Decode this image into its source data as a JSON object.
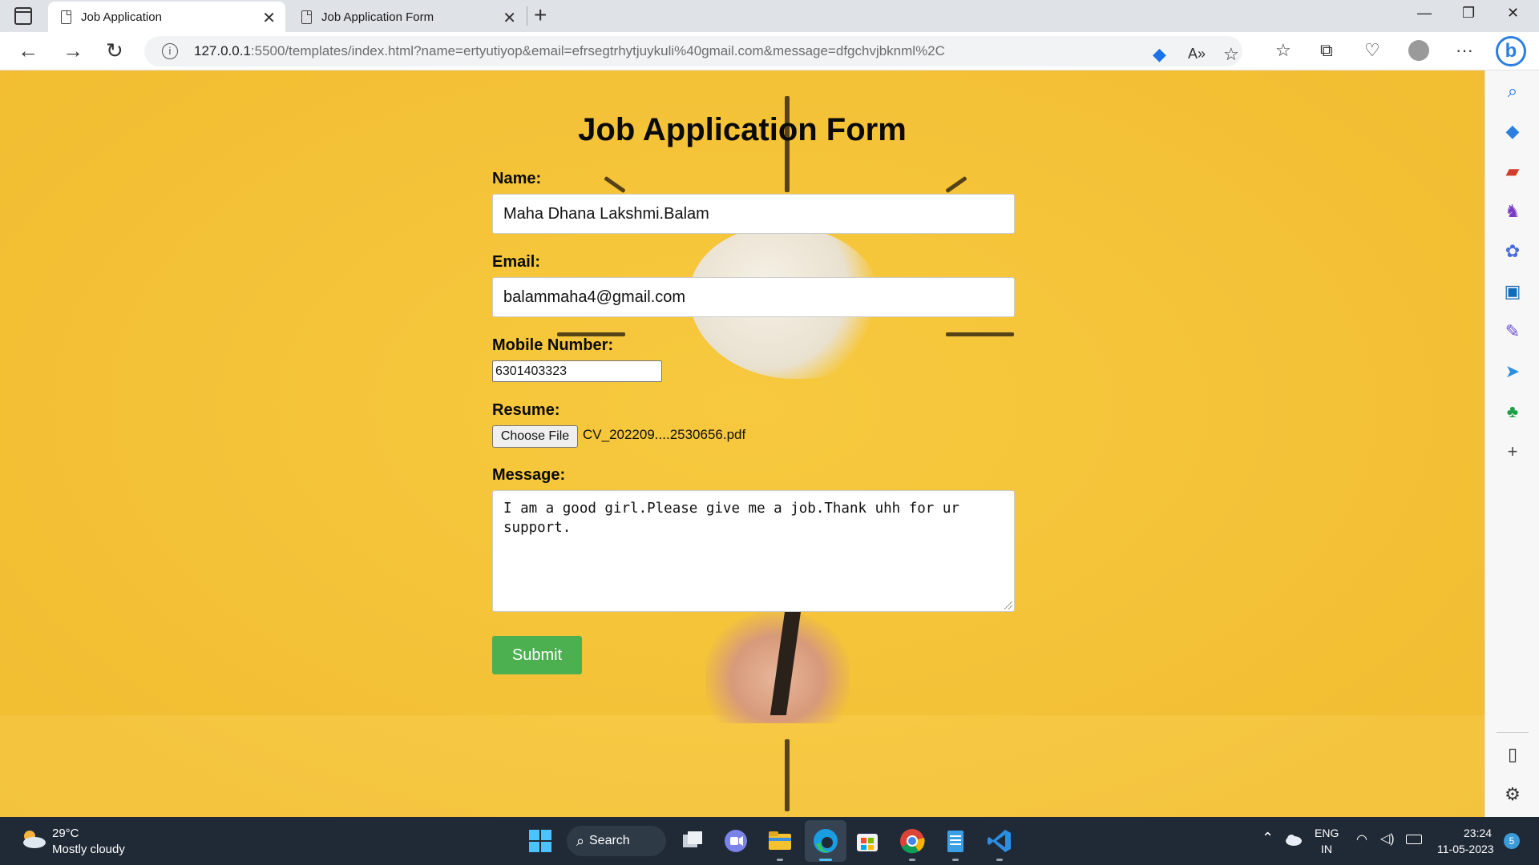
{
  "browser": {
    "tabs": [
      {
        "title": "Job Application",
        "active": true
      },
      {
        "title": "Job Application Form",
        "active": false
      }
    ],
    "url": {
      "host": "127.0.0.1",
      "rest": ":5500/templates/index.html?name=ertyutiyop&email=efrsegtrhytjuykuli%40gmail.com&message=dfgchvjbknml%2C"
    },
    "new_tab_label": "+"
  },
  "form": {
    "title": "Job Application Form",
    "name_label": "Name:",
    "name_value": "Maha Dhana Lakshmi.Balam",
    "email_label": "Email:",
    "email_value": "balammaha4@gmail.com",
    "mobile_label": "Mobile Number:",
    "mobile_value": "6301403323",
    "resume_label": "Resume:",
    "choose_file_label": "Choose File",
    "file_name": "CV_202209....2530656.pdf",
    "message_label": "Message:",
    "message_value": "I am a good girl.Please give me a job.Thank uhh for ur support.",
    "submit_label": "Submit",
    "submit_color": "#4caf50"
  },
  "sidebar": {
    "icons": [
      "search-icon",
      "tag-icon",
      "briefcase-icon",
      "chess-icon",
      "copilot-icon",
      "outlook-icon",
      "drop-icon",
      "send-icon",
      "tree-icon",
      "add-icon",
      "split-screen-icon",
      "settings-icon"
    ]
  },
  "taskbar": {
    "weather_temp": "29°C",
    "weather_condition": "Mostly cloudy",
    "search_label": "Search",
    "lang": "ENG",
    "region": "IN",
    "time": "23:24",
    "date": "11-05-2023",
    "notification_count": "5"
  },
  "colors": {
    "page_background": "#f5c43a",
    "taskbar": "#202a36",
    "accent": "#2b7fe0"
  }
}
